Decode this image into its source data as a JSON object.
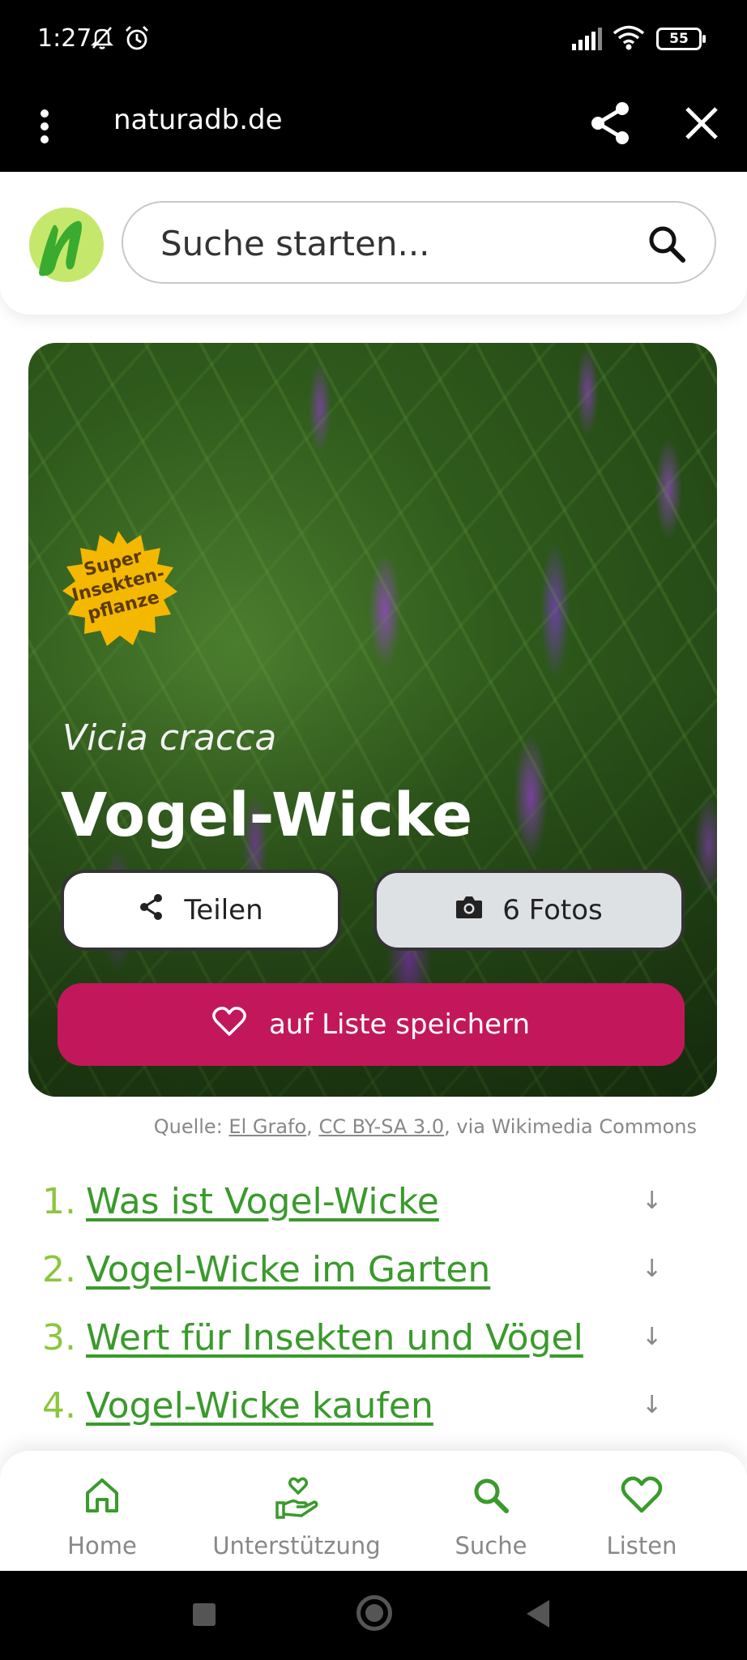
{
  "status_bar": {
    "time": "1:27",
    "battery": "55"
  },
  "browser": {
    "url": "naturadb.de"
  },
  "search": {
    "placeholder": "Suche starten..."
  },
  "hero": {
    "badge_lines": [
      "Super",
      "Insekten-",
      "pflanze"
    ],
    "latin_name": "Vicia cracca",
    "common_name": "Vogel-Wicke",
    "share_label": "Teilen",
    "photos_label": "6 Fotos",
    "save_label": "auf Liste speichern"
  },
  "source": {
    "prefix": "Quelle: ",
    "author": "El Grafo",
    "sep": ", ",
    "license": "CC BY-SA 3.0",
    "suffix": ", via Wikimedia Commons"
  },
  "toc": [
    {
      "num": "1.",
      "label": "Was ist Vogel-Wicke"
    },
    {
      "num": "2.",
      "label": "Vogel-Wicke im Garten"
    },
    {
      "num": "3.",
      "label": "Wert für Insekten und Vögel"
    },
    {
      "num": "4.",
      "label": "Vogel-Wicke kaufen"
    }
  ],
  "bottom_nav": [
    {
      "label": "Home",
      "icon": "home-icon"
    },
    {
      "label": "Unterstützung",
      "icon": "hand-heart-icon"
    },
    {
      "label": "Suche",
      "icon": "search-icon"
    },
    {
      "label": "Listen",
      "icon": "heart-icon"
    }
  ],
  "colors": {
    "accent_green": "#3a9a2c",
    "number_green": "#8cc63f",
    "save_button": "#c2185b",
    "badge": "#f5b800"
  }
}
